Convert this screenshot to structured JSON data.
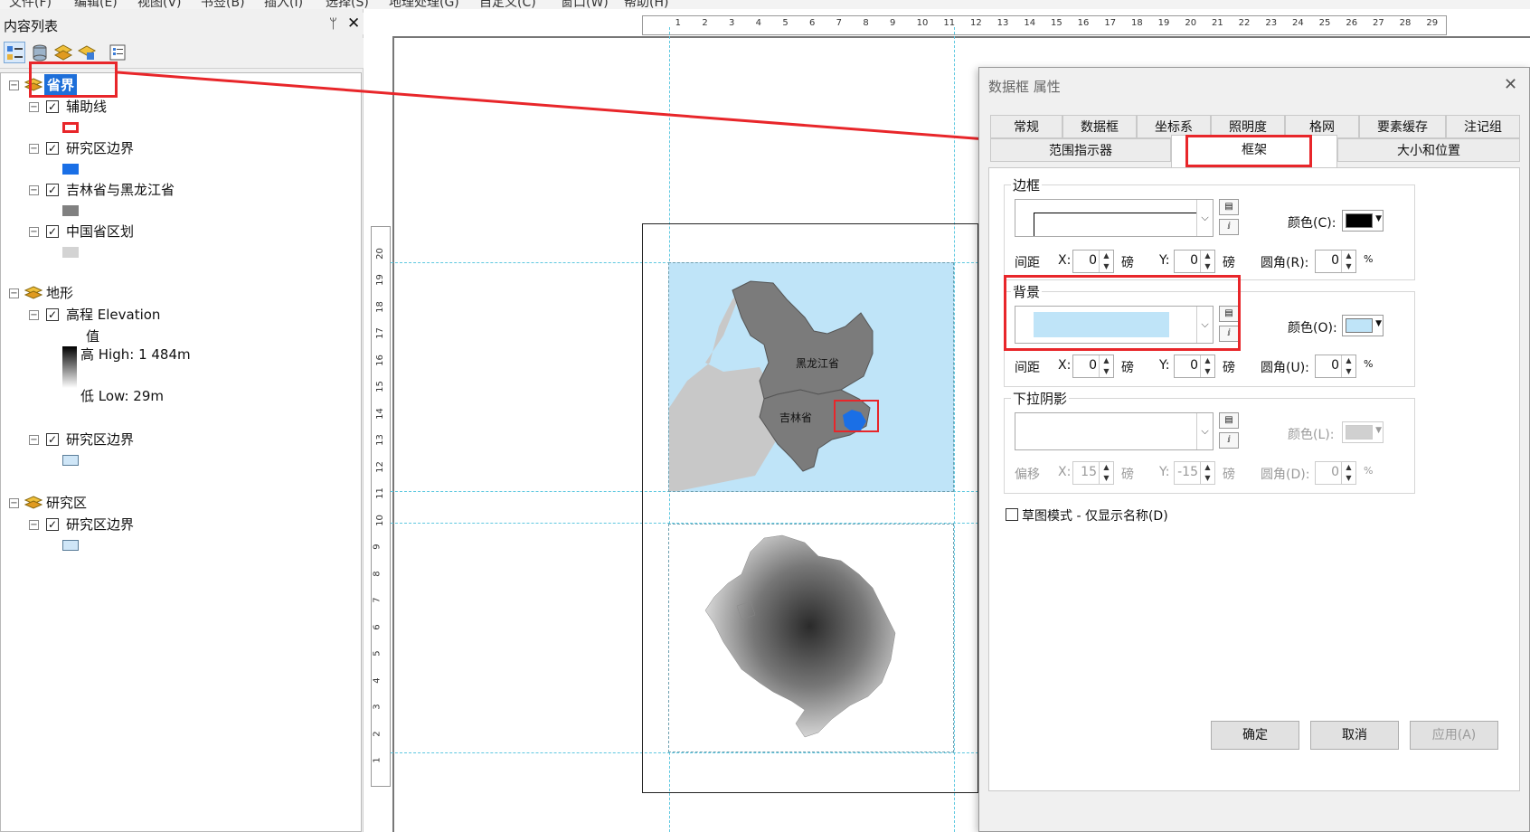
{
  "menubar": {
    "items": [
      "文件(F)",
      "编辑(E)",
      "视图(V)",
      "书签(B)",
      "插入(I)",
      "选择(S)",
      "地理处理(G)",
      "自定义(C)",
      "窗口(W)",
      "帮助(H)"
    ]
  },
  "toc": {
    "title": "内容列表",
    "pin_glyph": "ᛘ",
    "close_glyph": "✕",
    "groups": [
      {
        "name": "省界",
        "layers": [
          {
            "name": "辅助线",
            "symbol_color": "#e8262a"
          },
          {
            "name": "研究区边界",
            "symbol_color": "#1a6fe6"
          },
          {
            "name": "吉林省与黑龙江省",
            "symbol_color": "#808080"
          },
          {
            "name": "中国省区划",
            "symbol_color": "#d3d3d3"
          }
        ]
      },
      {
        "name": "地形",
        "layers": [
          {
            "name": "高程 Elevation",
            "legend_title": "值",
            "high": "高 High: 1 484m",
            "low": "低 Low: 29m"
          },
          {
            "name": "研究区边界",
            "symbol_color": "#cfe6f7"
          }
        ]
      },
      {
        "name": "研究区",
        "layers": [
          {
            "name": "研究区边界",
            "symbol_color": "#cfe6f7"
          }
        ]
      }
    ]
  },
  "ruler": {
    "h_ticks": [
      "1",
      "2",
      "3",
      "4",
      "5",
      "6",
      "7",
      "8",
      "9",
      "10",
      "11",
      "12",
      "13",
      "14",
      "15",
      "16",
      "17",
      "18",
      "19",
      "20",
      "21",
      "22",
      "23",
      "24",
      "25",
      "26",
      "27",
      "28",
      "29"
    ],
    "v_ticks": [
      "20",
      "19",
      "18",
      "17",
      "16",
      "15",
      "14",
      "13",
      "12",
      "11",
      "10",
      "9",
      "8",
      "7",
      "6",
      "5",
      "4",
      "3",
      "2",
      "1"
    ]
  },
  "map": {
    "label_heilongjiang": "黑龙江省",
    "label_jilin": "吉林省",
    "water_color": "#bfe4f8",
    "province_color": "#7b7b7b",
    "other_color": "#c8c8c8"
  },
  "dialog": {
    "title": "数据框 属性",
    "close_glyph": "✕",
    "tabs_row1": [
      "常规",
      "数据框",
      "坐标系",
      "照明度",
      "格网",
      "要素缓存",
      "注记组"
    ],
    "tabs_row2": [
      "范围指示器",
      "框架",
      "大小和位置"
    ],
    "selected_tab": "框架",
    "border": {
      "title": "边框",
      "color_label": "颜色(C):",
      "color": "#000000",
      "gap_label": "间距",
      "x_label": "X:",
      "x_value": "0",
      "y_label": "Y:",
      "y_value": "0",
      "unit": "磅",
      "corner_label": "圆角(R):",
      "corner_value": "0",
      "pct": "%"
    },
    "background": {
      "title": "背景",
      "color_label": "颜色(O):",
      "color": "#bfe4f8",
      "gap_label": "间距",
      "x_label": "X:",
      "x_value": "0",
      "y_label": "Y:",
      "y_value": "0",
      "unit": "磅",
      "corner_label": "圆角(U):",
      "corner_value": "0",
      "pct": "%"
    },
    "shadow": {
      "title": "下拉阴影",
      "color_label": "颜色(L):",
      "offset_label": "偏移",
      "x_label": "X:",
      "x_value": "15",
      "y_label": "Y:",
      "y_value": "-15",
      "unit": "磅",
      "corner_label": "圆角(D):",
      "corner_value": "0",
      "pct": "%"
    },
    "draft_mode": "草图模式 - 仅显示名称(D)",
    "buttons": {
      "ok": "确定",
      "cancel": "取消",
      "apply": "应用(A)"
    }
  }
}
